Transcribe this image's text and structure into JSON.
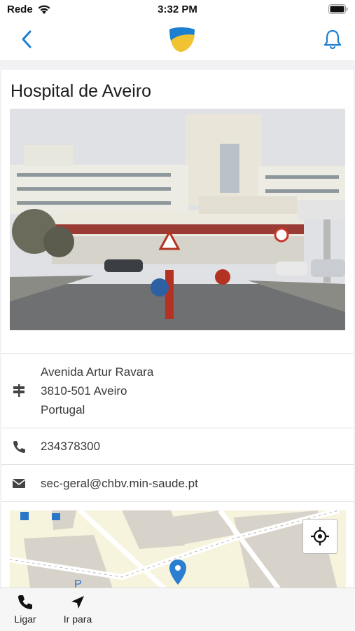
{
  "status_bar": {
    "carrier": "Rede",
    "time": "3:32 PM"
  },
  "nav": {
    "back_icon": "chevron-left-icon",
    "logo": "app-logo",
    "bell_icon": "bell-icon",
    "accent": "#1d7fd0"
  },
  "place": {
    "title": "Hospital de Aveiro",
    "address": [
      "Avenida Artur Ravara",
      "3810-501 Aveiro",
      "Portugal"
    ],
    "phone": "234378300",
    "email": "sec-geral@chbv.min-saude.pt"
  },
  "tabs": [
    {
      "label": "Ligar",
      "icon": "phone-icon"
    },
    {
      "label": "Ir para",
      "icon": "navigate-arrow-icon"
    }
  ]
}
